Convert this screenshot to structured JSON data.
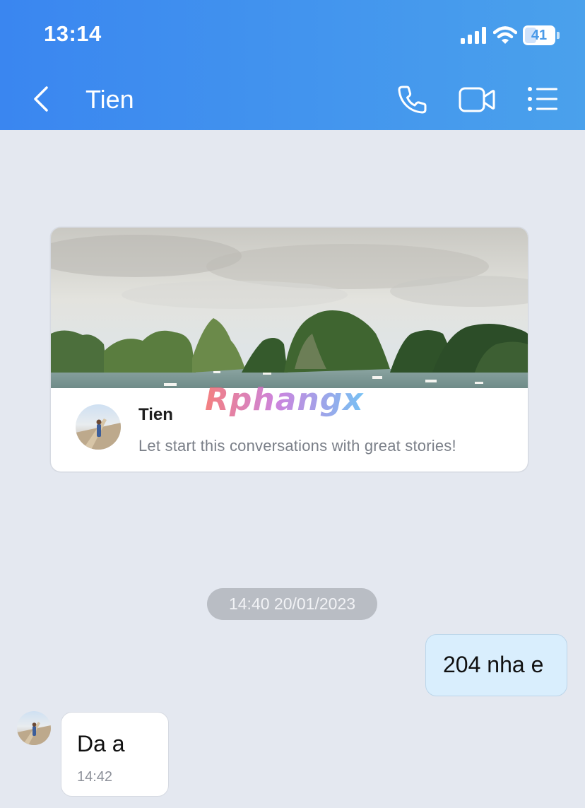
{
  "status_bar": {
    "time": "13:14",
    "battery": "41",
    "battery_level_pct": 41,
    "icons": [
      "signal-icon",
      "wifi-icon",
      "battery-icon"
    ]
  },
  "header": {
    "title": "Tien",
    "icons": [
      "back-chevron-icon",
      "phone-icon",
      "video-camera-icon",
      "list-menu-icon"
    ]
  },
  "profile_card": {
    "name": "Tien",
    "greeting": "Let start this conversations with great stories!"
  },
  "watermark": "Rphangx",
  "messages": {
    "date_separator": "14:40 20/01/2023",
    "sent": {
      "text": "204 nha e"
    },
    "received": {
      "text": "Da a",
      "time": "14:42"
    }
  },
  "colors": {
    "header_gradient_start": "#3a86f0",
    "header_gradient_end": "#4aa1ec",
    "chat_background": "#e4e8f0",
    "sent_bubble": "#d9eefd",
    "received_bubble": "#ffffff",
    "date_pill": "#b9bdc4"
  }
}
